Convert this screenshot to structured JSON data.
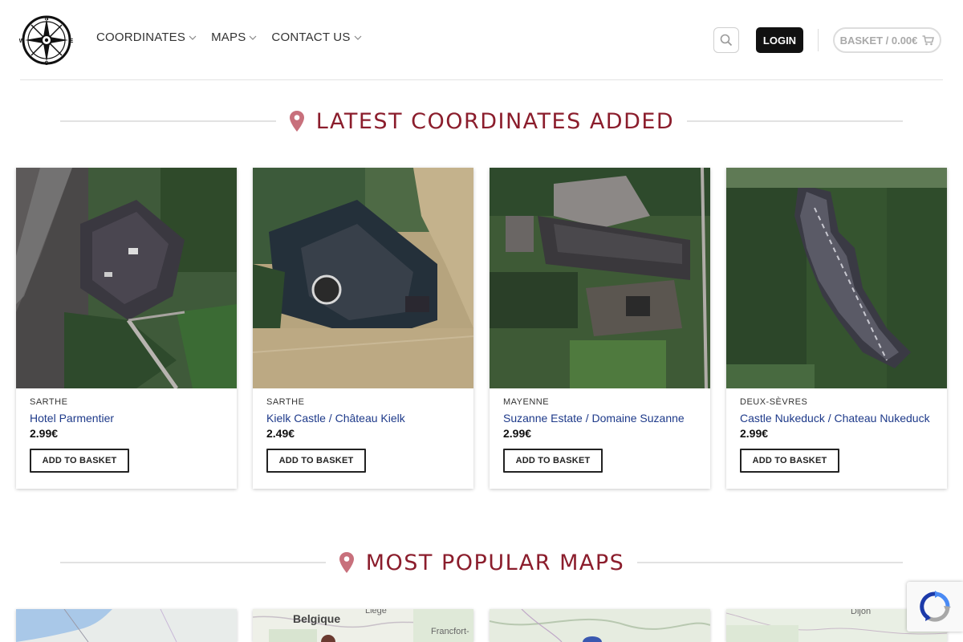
{
  "nav": {
    "items": [
      {
        "label": "COORDINATES"
      },
      {
        "label": "MAPS"
      },
      {
        "label": "CONTACT US"
      }
    ]
  },
  "header": {
    "login_label": "LOGIN",
    "basket_label": "BASKET / 0.00€",
    "logo_letters": {
      "n": "N",
      "e": "E",
      "s": "S",
      "w": "W"
    }
  },
  "sections": {
    "latest_title": "LATEST COORDINATES ADDED",
    "popular_title": "MOST POPULAR MAPS"
  },
  "products": [
    {
      "category": "SARTHE",
      "name": "Hotel Parmentier",
      "price": "2.99€",
      "button": "ADD TO BASKET"
    },
    {
      "category": "SARTHE",
      "name": "Kielk Castle / Château Kielk",
      "price": "2.49€",
      "button": "ADD TO BASKET"
    },
    {
      "category": "MAYENNE",
      "name": "Suzanne Estate / Domaine Suzanne",
      "price": "2.99€",
      "button": "ADD TO BASKET"
    },
    {
      "category": "DEUX-SÈVRES",
      "name": "Castle Nukeduck / Chateau Nukeduck",
      "price": "2.99€",
      "button": "ADD TO BASKET"
    }
  ],
  "maps": {
    "labels": {
      "belgique": "Belgique",
      "liege": "Liège",
      "francfort": "Francfort-",
      "dijon": "Dijon"
    }
  },
  "colors": {
    "accent": "#8b1d2c",
    "link": "#1e3a8a",
    "login_bg": "#111111"
  },
  "icons": [
    "compass-logo-icon",
    "chevron-down-icon",
    "search-icon",
    "cart-icon",
    "map-pin-icon",
    "recaptcha-icon"
  ]
}
